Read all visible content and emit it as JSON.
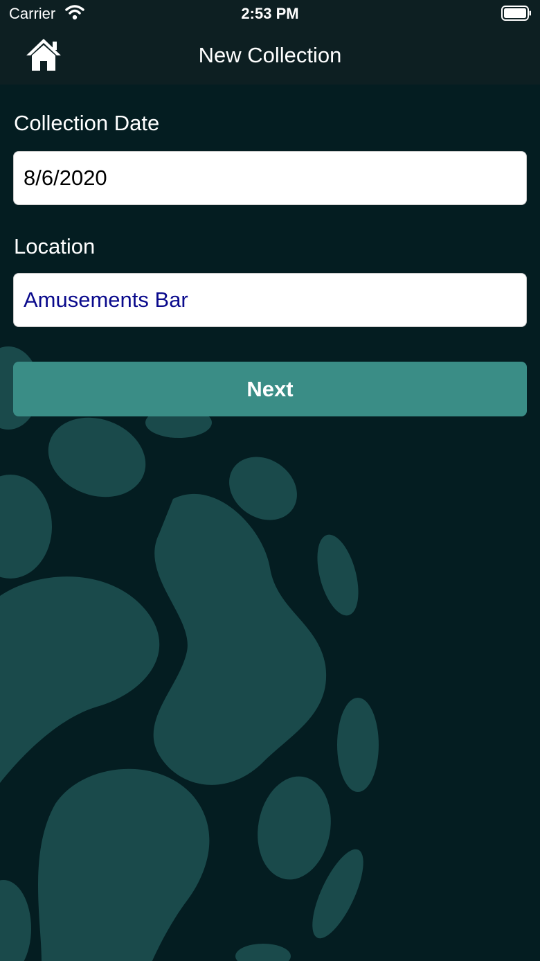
{
  "status_bar": {
    "carrier": "Carrier",
    "time": "2:53 PM",
    "wifi_icon": "wifi-icon",
    "battery_icon": "battery-icon"
  },
  "nav": {
    "title": "New Collection",
    "home_icon": "home-icon"
  },
  "form": {
    "date_label": "Collection Date",
    "date_value": "8/6/2020",
    "location_label": "Location",
    "location_value": "Amusements Bar",
    "next_label": "Next"
  },
  "colors": {
    "background": "#041d21",
    "nav_background": "#0d1f22",
    "blob": "#1a4a4b",
    "button": "#3a8d86",
    "location_text": "#0a0a8c"
  }
}
